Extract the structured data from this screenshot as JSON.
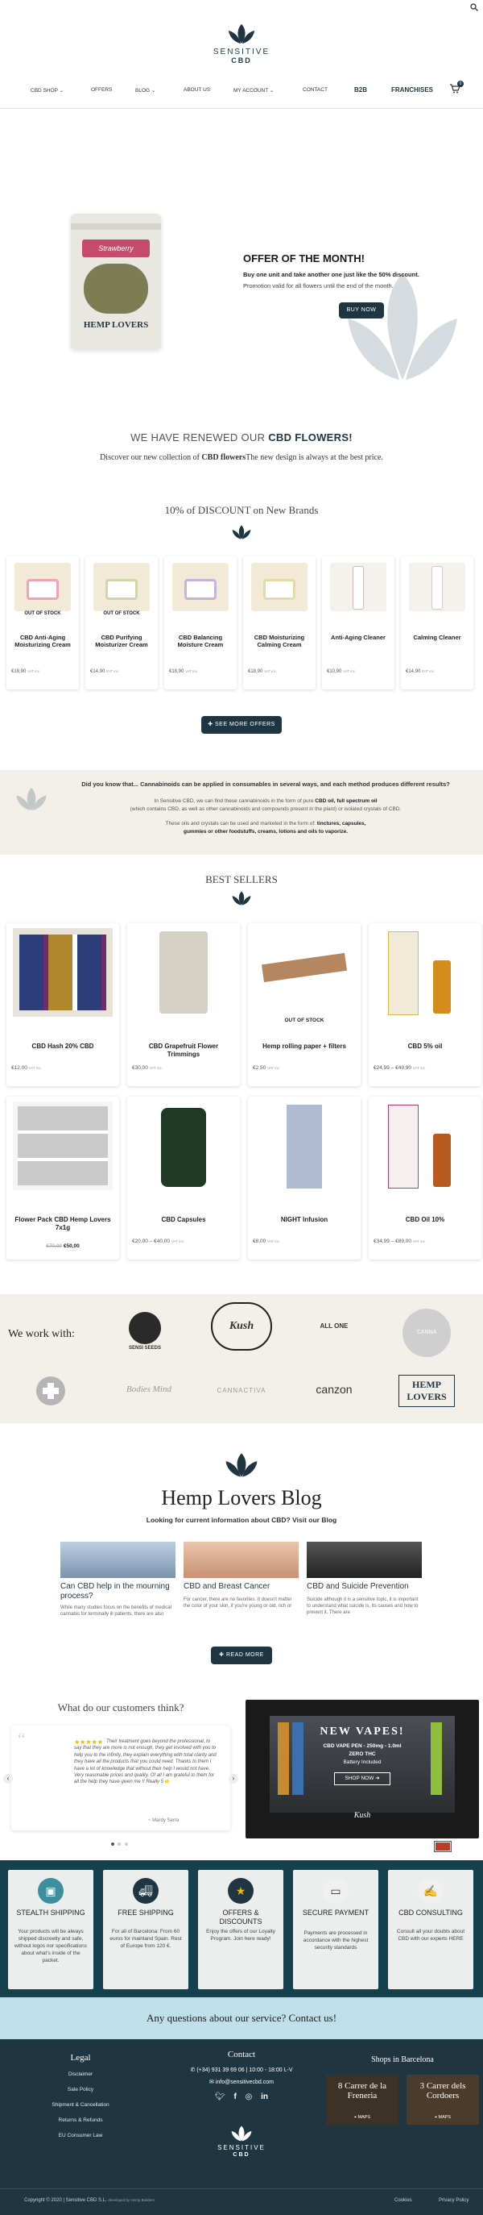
{
  "header": {
    "brand_line1": "SENSITIVE",
    "brand_line2": "CBD",
    "cart_count": "0",
    "nav": [
      {
        "label": "CBD SHOP"
      },
      {
        "label": "OFFERS"
      },
      {
        "label": "BLOG"
      },
      {
        "label": "ABOUT US"
      },
      {
        "label": "MY ACCOUNT"
      },
      {
        "label": "CONTACT"
      },
      {
        "label": "B2B"
      },
      {
        "label": "FRANCHISES"
      }
    ]
  },
  "hero": {
    "title": "OFFER OF THE MONTH!",
    "line1": "Buy one unit and take another one just like the 50% discount.",
    "line2": "Promotion valid for all flowers until the end of the month.",
    "button": "BUY NOW",
    "package_text": "Strawberry",
    "package_logo": "HEMP LOVERS"
  },
  "renewed": {
    "title_a": "WE HAVE RENEWED OUR ",
    "title_b": "CBD FLOWERS!",
    "sub_a": "Discover our new collection of ",
    "sub_b": "CBD flowers",
    "sub_c": "The new design is always at the best price."
  },
  "discount": {
    "title": "10% of DISCOUNT on New Brands",
    "button": "SEE MORE OFFERS",
    "products": [
      {
        "badge": "OUT OF STOCK",
        "name": "CBD Anti-Aging Moisturizing Cream",
        "price": "€19,90",
        "vat": "VAT inc."
      },
      {
        "badge": "OUT OF STOCK",
        "name": "CBD Purifying Moisturizer Cream",
        "price": "€14,90",
        "vat": "VAT inc."
      },
      {
        "badge": "",
        "name": "CBD Balancing Moisture Cream",
        "price": "€18,90",
        "vat": "VAT inc."
      },
      {
        "badge": "",
        "name": "CBD Moisturizing Calming Cream",
        "price": "€18,90",
        "vat": "VAT inc."
      },
      {
        "badge": "",
        "name": "Anti-Aging Cleaner",
        "price": "€10,90",
        "vat": "VAT inc."
      },
      {
        "badge": "",
        "name": "Calming Cleaner",
        "price": "€14,90",
        "vat": "VAT inc."
      }
    ]
  },
  "info": {
    "question": "Did you know that... Cannabinoids can be applied in consumables in several ways, and each method produces different results?",
    "p1a": "In Sensitive CBD, we can find these cannabinoids in the form of pure ",
    "p1b": "CBD oil, full spectrum oil",
    "p1c": "(which contains CBD, as well as other cannabinoids and compounds present in the plant) or isolated crystals of CBD.",
    "p2a": "These oils and crystals can be used and marketed in the form of: ",
    "p2b": "tinctures, capsules,",
    "p2c": "gummies or other foodstuffs, creams, lotions and oils to vaporize."
  },
  "best": {
    "title": "BEST SELLERS",
    "products": [
      {
        "badge": "",
        "name": "CBD Hash 20% CBD",
        "price": "€12,00",
        "old": "",
        "vat": "VAT inc."
      },
      {
        "badge": "",
        "name": "CBD Grapefruit Flower Trimmings",
        "price": "€30,00",
        "old": "",
        "vat": "VAT inc."
      },
      {
        "badge": "OUT OF STOCK",
        "name": "Hemp rolling paper + filters",
        "price": "€2,50",
        "old": "",
        "vat": "VAT inc."
      },
      {
        "badge": "",
        "name": "CBD 5% oil",
        "price": "€24,99 – €49,90",
        "old": "",
        "vat": "VAT inc."
      },
      {
        "badge": "",
        "name": "Flower Pack CBD Hemp Lovers 7x1g",
        "price": "€50,00",
        "old": "€70,00",
        "vat": ""
      },
      {
        "badge": "",
        "name": "CBD Capsules",
        "price": "€20,00 – €40,00",
        "old": "",
        "vat": "VAT inc."
      },
      {
        "badge": "",
        "name": "NIGHT Infusion",
        "price": "€8,00",
        "old": "",
        "vat": "VAT inc."
      },
      {
        "badge": "",
        "name": "CBD Oil 10%",
        "price": "€34,99 – €89,00",
        "old": "",
        "vat": "VAT inc."
      }
    ]
  },
  "partners": {
    "title": "We work with:",
    "logos_row1": [
      "SENSI SEEDS",
      "Kush",
      "ALL ONE",
      "CANNA"
    ],
    "logos_row2": [
      "",
      "Bodies Mind",
      "CANNACTIVA",
      "canzon",
      "HEMP LOVERS"
    ]
  },
  "blog": {
    "title": "Hemp Lovers Blog",
    "subtitle": "Looking for current information about CBD? Visit our Blog",
    "button": "READ MORE",
    "posts": [
      {
        "title": "Can CBD help in the mourning process?",
        "excerpt": "While many studies focus on the benefits of medical cannabis for terminally ill patients, there are also"
      },
      {
        "title": "CBD and Breast Cancer",
        "excerpt": "For cancer, there are no favorites. It doesn't matter the color of your skin, if you're young or old, rich or"
      },
      {
        "title": "CBD and Suicide Prevention",
        "excerpt": "Suicide although it is a sensitive topic, it is important to understand what suicide is, its causes and how to prevent it. There are"
      }
    ]
  },
  "reviews": {
    "title": "What do our customers think?",
    "text": "Their treatment goes beyond the professional, to say that they are more is not enough, they get involved with you to help you to the infinity, they explain everything with total clarity and they have all the products that you could need. Thanks to them I have a lot of knowledge that without their help I would not have. Very reasonable prices and quality. Of all I am grateful to them for all the help they have given me !! Really 5⭐",
    "author": "~ Mardy Serra",
    "promo_title": "NEW VAPES!",
    "promo_l1": "CBD VAPE PEN - 250mg - 1.0ml",
    "promo_l2": "ZERO THC",
    "promo_l3": "Battery Included",
    "promo_button": "SHOP NOW",
    "promo_tag": "Kush"
  },
  "features": [
    {
      "title": "STEALTH SHIPPING",
      "text": "Your products will be always shipped discreetly and safe, without logos nor specifications about what's inside of the packet."
    },
    {
      "title": "FREE SHIPPING",
      "text": "For all of Barcelona: From 60 euros for mainland Spain. Rest of Europe from 120 €."
    },
    {
      "title": "OFFERS & DISCOUNTS",
      "text": "Enjoy the offers of our Loyalty Program. Join here ready!"
    },
    {
      "title": "SECURE PAYMENT",
      "text": "Payments are processed in accordance with the highest security standards"
    },
    {
      "title": "CBD CONSULTING",
      "text": "Consult all your doubts about CBD with our experts HERE"
    }
  ],
  "contact_banner": "Any questions about our service? Contact us!",
  "footer": {
    "legal_title": "Legal",
    "legal": [
      "Disclaimer",
      "Sale Policy",
      "Shipment & Cancellation",
      "Returns & Refunds",
      "EU Consumer Law"
    ],
    "contact_title": "Contact",
    "phone": "(+34) 931 39 69 06 | 10:00 - 18:00 L-V",
    "email": "info@sensitivecbd.com",
    "shops_title": "Shops in Barcelona",
    "shop1": "8 Carrer de la Freneria",
    "shop2": "3 Carrer dels Cordoers",
    "shop_btn": "MAPS",
    "brand_line1": "SENSITIVE",
    "brand_line2": "CBD",
    "copyright": "Copyright © 2020 | Sensitive CBD S.L.",
    "dev": "developed by Hemp Builders",
    "cookies": "Cookies",
    "privacy": "Privacy Policy"
  },
  "colors": {
    "navy": "#1f3642",
    "leaf": "#d6dbdf",
    "star": "#f5b400",
    "beige": "#f3efe9",
    "teal": "#15404e"
  }
}
